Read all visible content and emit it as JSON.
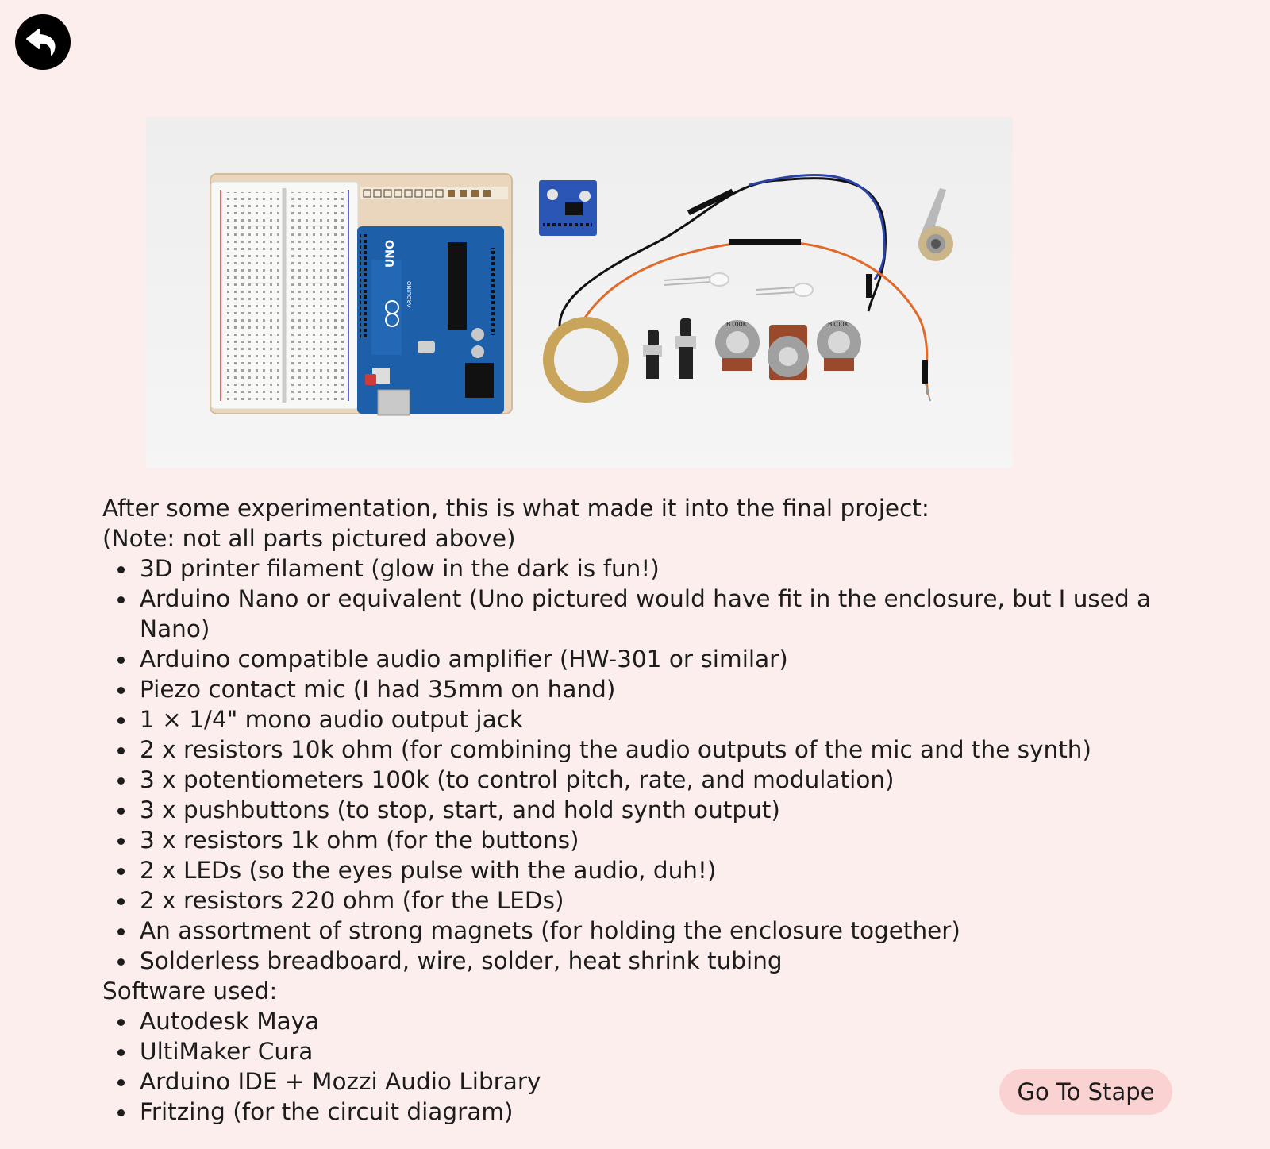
{
  "icons": {
    "back": "undo-arrow-icon"
  },
  "colors": {
    "background": "#fdeeee",
    "button_bg": "#fbd2d2",
    "text": "#1c1c1c"
  },
  "intro": {
    "line1": "After some experimentation, this is what made it into the final project:",
    "line2": "(Note: not all parts pictured above)"
  },
  "parts": [
    "3D printer filament (glow in the dark is fun!)",
    "Arduino Nano or equivalent (Uno pictured would have fit in the enclosure, but I used a Nano)",
    "Arduino compatible audio amplifier (HW-301 or similar)",
    "Piezo contact mic (I had 35mm on hand)",
    "1 × 1/4\" mono audio output jack",
    "2 x resistors 10k ohm (for combining the audio outputs of the mic and the synth)",
    "3 x potentiometers 100k (to control pitch, rate, and modulation)",
    "3 x pushbuttons (to stop, start, and hold synth output)",
    "3 x resistors 1k ohm (for the buttons)",
    "2 x LEDs (so the eyes pulse with the audio, duh!)",
    "2 x resistors 220 ohm (for the LEDs)",
    "An assortment of strong magnets (for holding the enclosure together)",
    "Solderless breadboard, wire, solder, heat shrink tubing"
  ],
  "software_heading": "Software used:",
  "software": [
    "Autodesk Maya",
    "UltiMaker Cura",
    "Arduino IDE + Mozzi Audio Library",
    "Fritzing (for the circuit diagram)"
  ],
  "goto_button": "Go To Stape",
  "photo_labels": {
    "uno": "UNO",
    "arduino": "ARDUINO",
    "pot1": "B100K",
    "pot2": "B100K",
    "pot3": "B100K"
  }
}
